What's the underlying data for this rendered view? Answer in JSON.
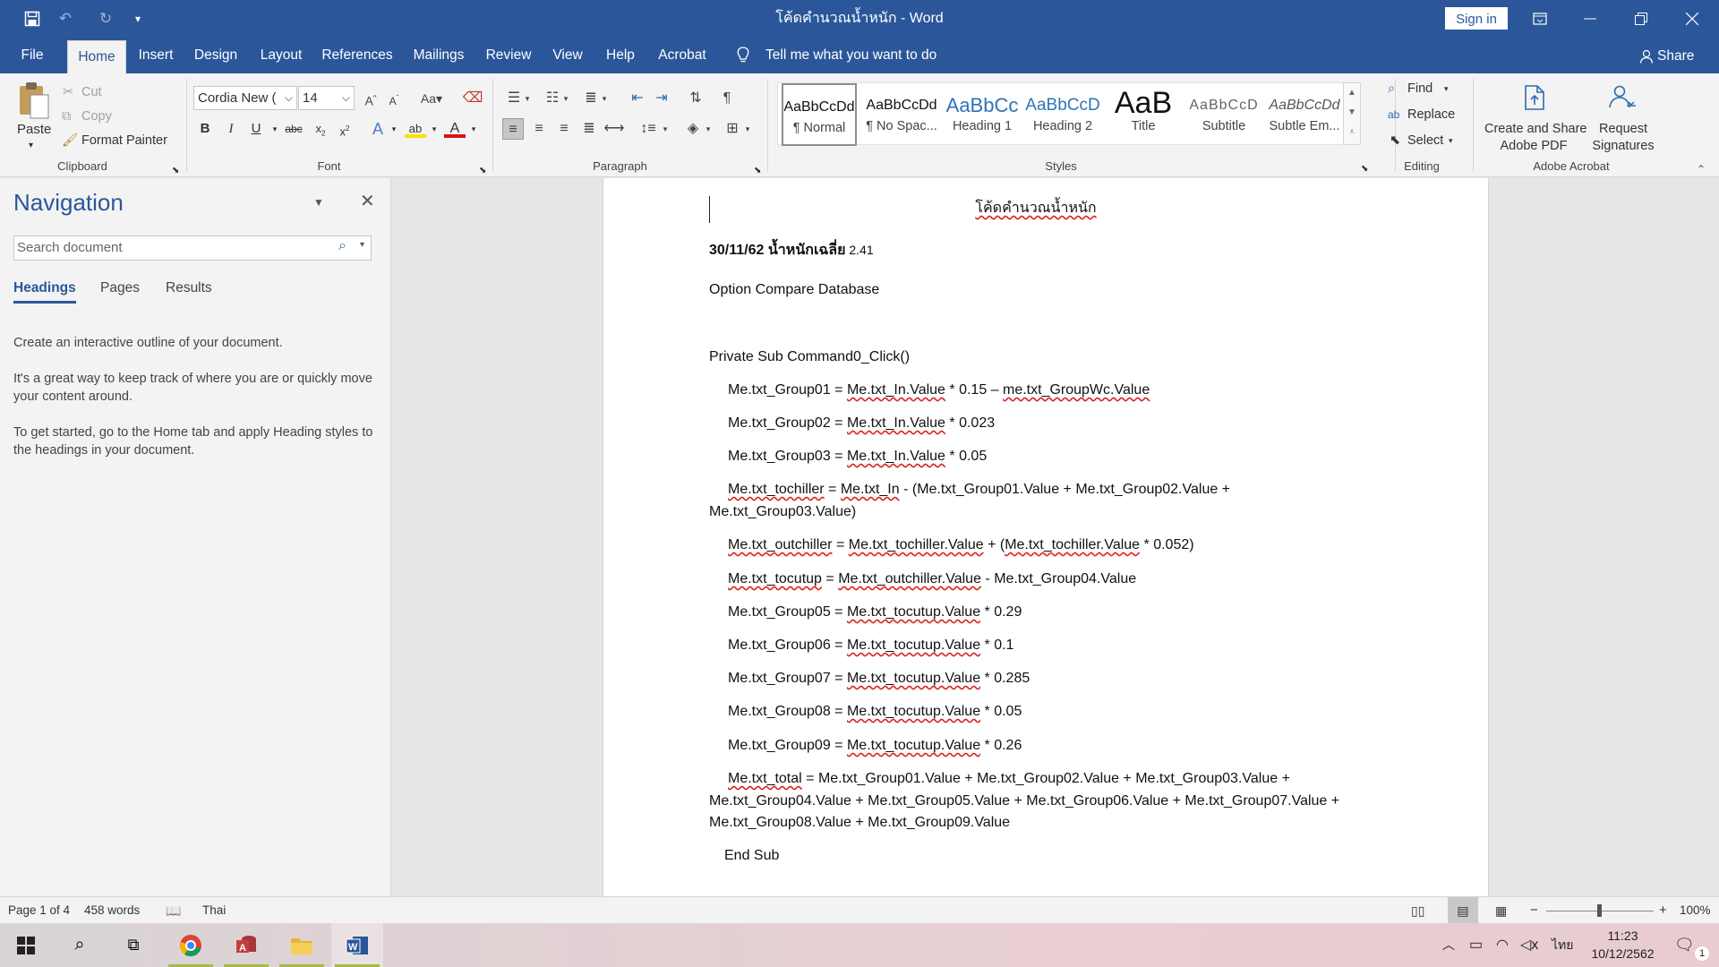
{
  "window": {
    "title": "โค้ดคำนวณน้ำหนัก  -  Word",
    "sign_in": "Sign in"
  },
  "quick_access": {
    "icons": [
      "save-icon",
      "undo-icon",
      "redo-icon",
      "customize-icon"
    ]
  },
  "tabs": [
    "File",
    "Home",
    "Insert",
    "Design",
    "Layout",
    "References",
    "Mailings",
    "Review",
    "View",
    "Help",
    "Acrobat"
  ],
  "active_tab": "Home",
  "tell_me": "Tell me what you want to do",
  "share": "Share",
  "ribbon": {
    "clipboard": {
      "paste": "Paste",
      "cut": "Cut",
      "copy": "Copy",
      "format_painter": "Format Painter",
      "label": "Clipboard"
    },
    "font": {
      "font_name": "Cordia New (",
      "font_size": "14",
      "label": "Font"
    },
    "paragraph": {
      "label": "Paragraph"
    },
    "styles": {
      "label": "Styles",
      "items": [
        {
          "preview": "AaBbCcDd",
          "name": "¶ Normal"
        },
        {
          "preview": "AaBbCcDd",
          "name": "¶ No Spac..."
        },
        {
          "preview": "AaBbCc",
          "name": "Heading 1"
        },
        {
          "preview": "AaBbCcD",
          "name": "Heading 2"
        },
        {
          "preview": "AaB",
          "name": "Title"
        },
        {
          "preview": "AaBbCcD",
          "name": "Subtitle"
        },
        {
          "preview": "AaBbCcDd",
          "name": "Subtle Em..."
        }
      ]
    },
    "editing": {
      "find": "Find",
      "replace": "Replace",
      "select": "Select",
      "label": "Editing"
    },
    "acrobat": {
      "create": "Create and Share",
      "create2": "Adobe PDF",
      "request": "Request",
      "request2": "Signatures",
      "label": "Adobe Acrobat"
    }
  },
  "navigation": {
    "title": "Navigation",
    "search_placeholder": "Search document",
    "tabs": [
      "Headings",
      "Pages",
      "Results"
    ],
    "text1": "Create an interactive outline of your document.",
    "text2": "It's a great way to keep track of where you are or quickly move your content around.",
    "text3": "To get started, go to the Home tab and apply Heading styles to the headings in your document."
  },
  "document": {
    "heading": "โค้ดคำนวณน้ำหนัก",
    "date_bold": "30/11/62 น้ำหนักเฉลี่ย",
    "date_val": " 2.41",
    "option": "Option Compare Database",
    "sub_start": "Private Sub Command0_Click()",
    "l1": [
      "Me.txt_Group01 = ",
      "Me.txt_In.Value",
      " * 0.15 – ",
      "me.txt_GroupWc.Value"
    ],
    "l2": [
      "Me.txt_Group02 = ",
      "Me.txt_In.Value",
      " * 0.023"
    ],
    "l3": [
      "Me.txt_Group03 = ",
      "Me.txt_In.Value",
      " * 0.05"
    ],
    "l4a": [
      "Me.txt_tochiller",
      " = ",
      "Me.txt_In",
      " - (Me.txt_Group01.Value + Me.txt_Group02.Value +"
    ],
    "l4b": "Me.txt_Group03.Value)",
    "l5": [
      "Me.txt_outchiller",
      " = ",
      "Me.txt_tochiller.Value",
      " + (",
      "Me.txt_tochiller.Value",
      " * 0.052)"
    ],
    "l6": [
      "Me.txt_tocutup",
      " = ",
      "Me.txt_outchiller.Value",
      " - Me.txt_Group04.Value"
    ],
    "l7": [
      "Me.txt_Group05 = ",
      "Me.txt_tocutup.Value",
      " * 0.29"
    ],
    "l8": [
      "Me.txt_Group06 = ",
      "Me.txt_tocutup.Value",
      " * 0.1"
    ],
    "l9": [
      "Me.txt_Group07 = ",
      "Me.txt_tocutup.Value",
      " * 0.285"
    ],
    "l10": [
      "Me.txt_Group08 = ",
      "Me.txt_tocutup.Value",
      " * 0.05"
    ],
    "l11": [
      "Me.txt_Group09 = ",
      "Me.txt_tocutup.Value",
      " * 0.26"
    ],
    "l12a": [
      "Me.txt_total",
      " = Me.txt_Group01.Value + Me.txt_Group02.Value + Me.txt_Group03.Value +"
    ],
    "l12b": "Me.txt_Group04.Value + Me.txt_Group05.Value + Me.txt_Group06.Value + Me.txt_Group07.Value +",
    "l12c": "Me.txt_Group08.Value + Me.txt_Group09.Value",
    "sub_end": "End Sub"
  },
  "status": {
    "page": "Page 1 of 4",
    "words": "458 words",
    "language": "Thai",
    "zoom": "100%"
  },
  "taskbar": {
    "time": "11:23",
    "date": "10/12/2562",
    "lang": "ไทย",
    "notif_count": "1"
  }
}
